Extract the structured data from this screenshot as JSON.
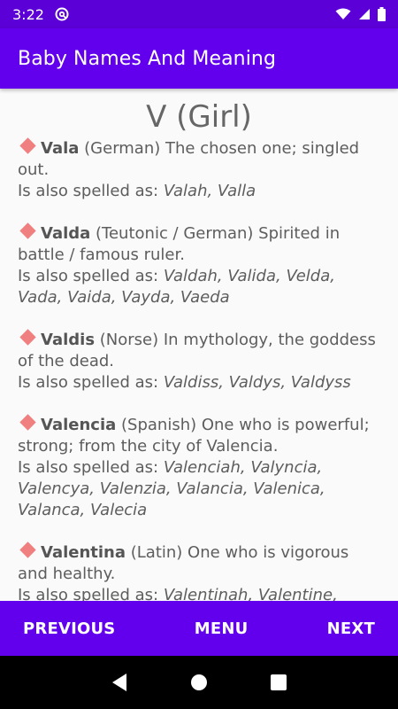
{
  "status_bar": {
    "time": "3:22",
    "icons": [
      "at-icon",
      "wifi-icon",
      "signal-icon",
      "battery-icon"
    ]
  },
  "app_bar": {
    "title": "Baby Names And Meaning"
  },
  "content": {
    "heading": "V (Girl)",
    "spelled_prefix": "Is also spelled as: ",
    "entries": [
      {
        "name": "Vala",
        "origin_meaning": " (German) The chosen one; singled out.",
        "spellings": "Valah, Valla"
      },
      {
        "name": "Valda",
        "origin_meaning": " (Teutonic / German) Spirited in battle / famous ruler.",
        "spellings": "Valdah, Valida, Velda, Vada, Vaida, Vayda, Vaeda"
      },
      {
        "name": "Valdis",
        "origin_meaning": " (Norse) In mythology, the goddess of the dead.",
        "spellings": "Valdiss, Valdys, Valdyss"
      },
      {
        "name": "Valencia",
        "origin_meaning": " (Spanish) One who is powerful; strong; from the city of Valencia.",
        "spellings": "Valenciah, Valyncia, Valencya, Valenzia, Valancia, Valenica, Valanca, Valecia"
      },
      {
        "name": "Valentina",
        "origin_meaning": " (Latin) One who is vigorous and healthy.",
        "spellings": "Valentinah, Valentine,"
      }
    ]
  },
  "bottom_bar": {
    "previous": "PREVIOUS",
    "menu": "MENU",
    "next": "NEXT"
  },
  "colors": {
    "primary": "#6200ee",
    "status_bar": "#5b00d6",
    "diamond": "#f08080"
  }
}
